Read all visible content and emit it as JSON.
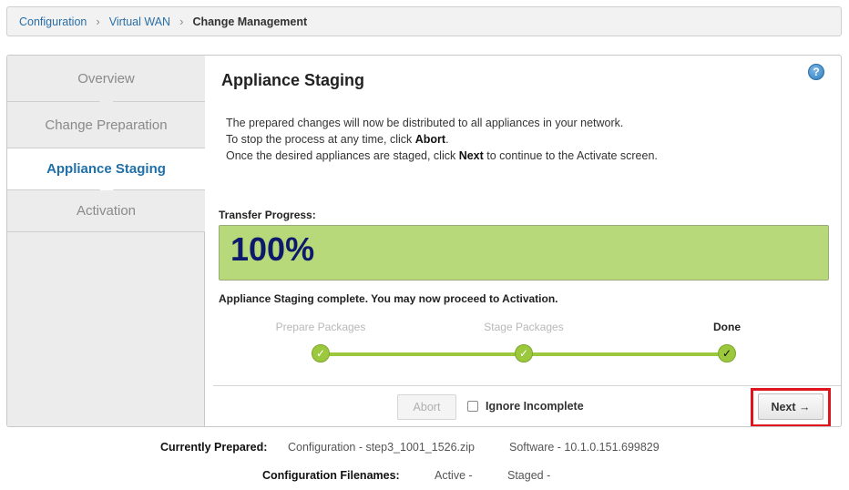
{
  "breadcrumb": {
    "items": [
      "Configuration",
      "Virtual WAN"
    ],
    "current": "Change Management"
  },
  "sidebar": {
    "steps": [
      {
        "label": "Overview",
        "active": false
      },
      {
        "label": "Change Preparation",
        "active": false
      },
      {
        "label": "Appliance Staging",
        "active": true
      },
      {
        "label": "Activation",
        "active": false
      }
    ]
  },
  "content": {
    "title": "Appliance Staging",
    "help_icon": "question-icon",
    "desc_line1": "The prepared changes will now be distributed to all appliances in your network.",
    "desc_line2_pre": "To stop the process at any time, click ",
    "desc_line2_bold": "Abort",
    "desc_line2_post": ".",
    "desc_line3_pre": "Once the desired appliances are staged, click ",
    "desc_line3_bold": "Next",
    "desc_line3_post": " to continue to the Activate screen.",
    "transfer_label": "Transfer Progress:",
    "progress_text": "100%",
    "progress_fraction": 1.0,
    "complete_message": "Appliance Staging complete. You may now proceed to Activation.",
    "stages": [
      {
        "label": "Prepare Packages",
        "done": false
      },
      {
        "label": "Stage Packages",
        "done": false
      },
      {
        "label": "Done",
        "done": true
      }
    ],
    "check_glyph": "✓",
    "abort_label": "Abort",
    "ignore_label": "Ignore Incomplete",
    "next_label": "Next →"
  },
  "info": {
    "currently_prepared_label": "Currently Prepared:",
    "configuration_text": "Configuration - step3_1001_1526.zip",
    "software_text": "Software - 10.1.0.151.699829",
    "filenames_label": "Configuration Filenames:",
    "active_text": "Active -",
    "staged_text": "Staged -"
  },
  "colors": {
    "accent_blue": "#1f6fa8",
    "progress_green": "#b8d97a",
    "stage_green": "#9bc83c",
    "highlight_red": "#e0141c"
  }
}
